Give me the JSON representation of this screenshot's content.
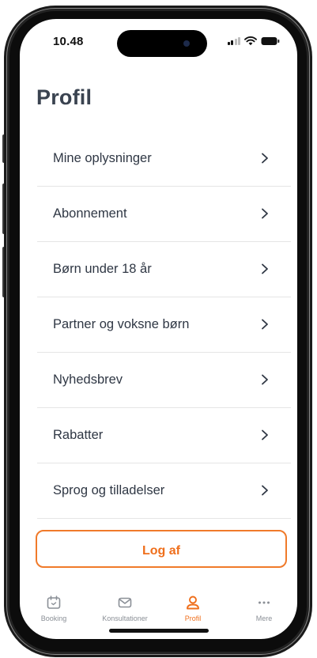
{
  "status_bar": {
    "time": "10.48"
  },
  "page": {
    "title": "Profil"
  },
  "menu": {
    "items": [
      {
        "label": "Mine oplysninger"
      },
      {
        "label": "Abonnement"
      },
      {
        "label": "Børn under 18 år"
      },
      {
        "label": "Partner og voksne børn"
      },
      {
        "label": "Nyhedsbrev"
      },
      {
        "label": "Rabatter"
      },
      {
        "label": "Sprog og tilladelser"
      }
    ]
  },
  "logout_label": "Log af",
  "tabs": [
    {
      "label": "Booking",
      "icon": "calendar-icon",
      "active": false
    },
    {
      "label": "Konsultationer",
      "icon": "envelope-icon",
      "active": false
    },
    {
      "label": "Profil",
      "icon": "user-icon",
      "active": true
    },
    {
      "label": "Mere",
      "icon": "more-dots-icon",
      "active": false
    }
  ],
  "colors": {
    "accent": "#ef6f1c",
    "text": "#2f3744",
    "title": "#3a4350",
    "tab_inactive": "#8a8f96"
  }
}
